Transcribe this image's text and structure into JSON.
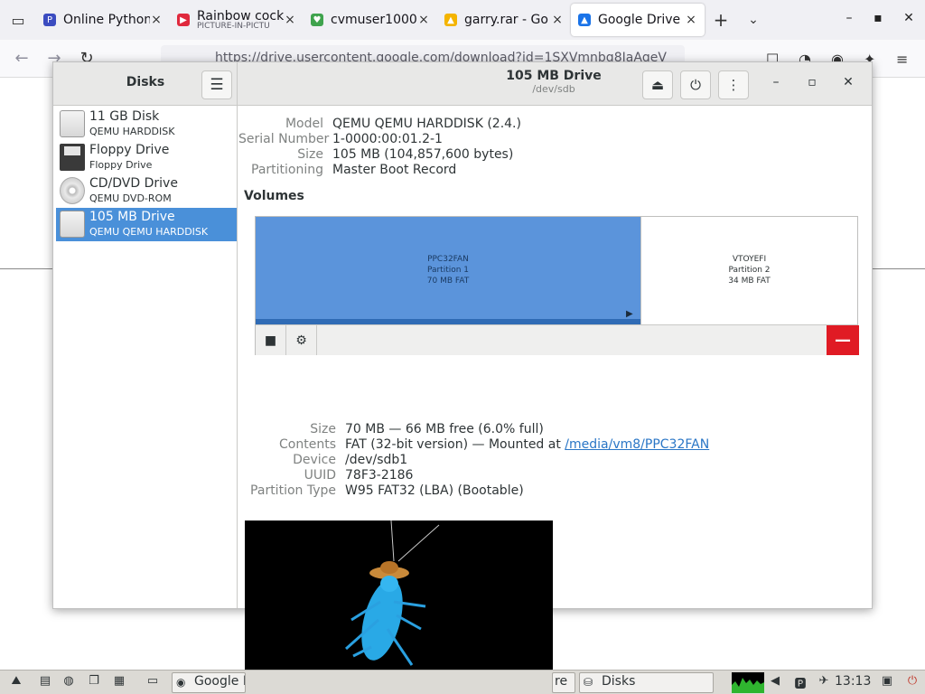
{
  "firefox": {
    "tabs": [
      {
        "title": "Online Python",
        "favicon_color": "#3b4cc0",
        "favicon": "P"
      },
      {
        "title": "Rainbow cock",
        "subtitle": "PICTURE-IN-PICTU",
        "favicon_color": "#e0293d",
        "favicon": "▶"
      },
      {
        "title": "cvmuser1000",
        "favicon_color": "#3fa34d",
        "favicon": "♥"
      },
      {
        "title": "garry.rar - Go",
        "favicon_color": "#f4b400",
        "favicon": "▲"
      },
      {
        "title": "Google Drive",
        "favicon_color": "#1a73e8",
        "favicon": "▲"
      }
    ],
    "url": "https://drive.usercontent.google.com/download?id=1SXVmnbg8IaAgeV"
  },
  "header": {
    "sidebar_title": "Disks",
    "drive_title": "105 MB Drive",
    "drive_subtitle": "/dev/sdb"
  },
  "sidebar": {
    "items": [
      {
        "name": "11 GB Disk",
        "sub": "QEMU HARDDISK",
        "icon": "hdd"
      },
      {
        "name": "Floppy Drive",
        "sub": "Floppy Drive",
        "icon": "floppy"
      },
      {
        "name": "CD/DVD Drive",
        "sub": "QEMU DVD-ROM",
        "icon": "cd"
      },
      {
        "name": "105 MB Drive",
        "sub": "QEMU QEMU HARDDISK",
        "icon": "hdd"
      }
    ],
    "selected_index": 3
  },
  "drive_info": [
    {
      "key": "Model",
      "value": "QEMU QEMU HARDDISK (2.4.)"
    },
    {
      "key": "Serial Number",
      "value": "1-0000:00:01.2-1"
    },
    {
      "key": "Size",
      "value": "105 MB (104,857,600 bytes)"
    },
    {
      "key": "Partitioning",
      "value": "Master Boot Record"
    }
  ],
  "volumes": {
    "title": "Volumes",
    "partitions": [
      {
        "label": "PPC32FAN",
        "number": "Partition 1",
        "size": "70 MB FAT",
        "fraction": 0.667
      },
      {
        "label": "VTOYEFI",
        "number": "Partition 2",
        "size": "34 MB FAT",
        "fraction": 0.333
      }
    ],
    "colors": {
      "selected": "#5b94db",
      "usage_bar": "#2f6bb5",
      "delete": "#e01b24"
    }
  },
  "partition_info": [
    {
      "key": "Size",
      "value": "70 MB — 66 MB free (6.0% full)"
    },
    {
      "key": "Contents",
      "value": "FAT (32-bit version) — Mounted at ",
      "link": "/media/vm8/PPC32FAN"
    },
    {
      "key": "Device",
      "value": "/dev/sdb1"
    },
    {
      "key": "UUID",
      "value": "78F3-2186"
    },
    {
      "key": "Partition Type",
      "value": "W95 FAT32 (LBA) (Bootable)"
    }
  ],
  "taskbar": {
    "tasks": [
      {
        "label": "Google D",
        "icon": "firefox"
      },
      {
        "label": "re",
        "icon": "window"
      },
      {
        "label": "Disks",
        "icon": "disks"
      }
    ],
    "clock": "13:13"
  }
}
